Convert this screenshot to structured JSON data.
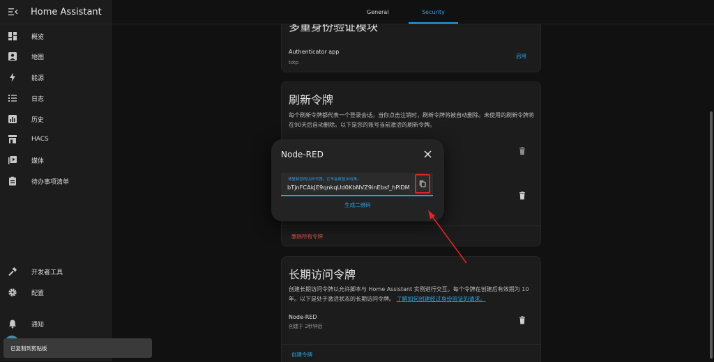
{
  "sidebar": {
    "title": "Home Assistant",
    "items": [
      {
        "label": "概览",
        "icon": "dashboard-icon"
      },
      {
        "label": "地图",
        "icon": "map-icon"
      },
      {
        "label": "能源",
        "icon": "lightning-bolt-icon"
      },
      {
        "label": "日志",
        "icon": "list-icon"
      },
      {
        "label": "历史",
        "icon": "chart-box-icon"
      },
      {
        "label": "HACS",
        "icon": "hacs-icon"
      },
      {
        "label": "媒体",
        "icon": "play-box-multiple-icon"
      },
      {
        "label": "待办事项清单",
        "icon": "clipboard-list-icon"
      }
    ],
    "dev_tools": "开发者工具",
    "settings": "配置",
    "notifications": "通知"
  },
  "tabs": [
    {
      "label": "General",
      "active": false
    },
    {
      "label": "Security",
      "active": true
    }
  ],
  "mfa_card": {
    "title": "多重身份验证模块",
    "module_name": "Authenticator app",
    "module_id": "totp",
    "enable_label": "启用"
  },
  "refresh_card": {
    "title": "刷新令牌",
    "description": "每个刷新令牌都代表一个登录会话。当你点击注销时，刷新令牌将被自动删除。未使用的刷新令牌将在90天后自动删除。以下是您的账号当前激活的刷新令牌。",
    "delete_all_label": "删除所有令牌"
  },
  "long_lived_card": {
    "title": "长期访问令牌",
    "description": "创建长期访问令牌以允许脚本与 Home Assistant 实例进行交互。每个令牌在创建后有效期为 10 年。以下是处于激活状态的长期访问令牌。",
    "learn_link": "了解如何创建经过身份验证的请求。",
    "token_name": "Node-RED",
    "token_created": "创建于 2秒钟后",
    "create_label": "创建令牌"
  },
  "dialog": {
    "title": "Node-RED",
    "field_label": "请复制您的访问令牌。它不会再显示出来。",
    "token_value": "bTjnFCAkJE9qnkqUd0KbNVZ9inEbsf_hPiDM",
    "qr_label": "生成二维码"
  },
  "toast": {
    "message": "已复制到剪贴板"
  },
  "colors": {
    "accent": "#2aa0e2",
    "danger": "#d9584a",
    "highlight": "#e0242b",
    "background": "#111111",
    "card": "#1c1c1c"
  }
}
